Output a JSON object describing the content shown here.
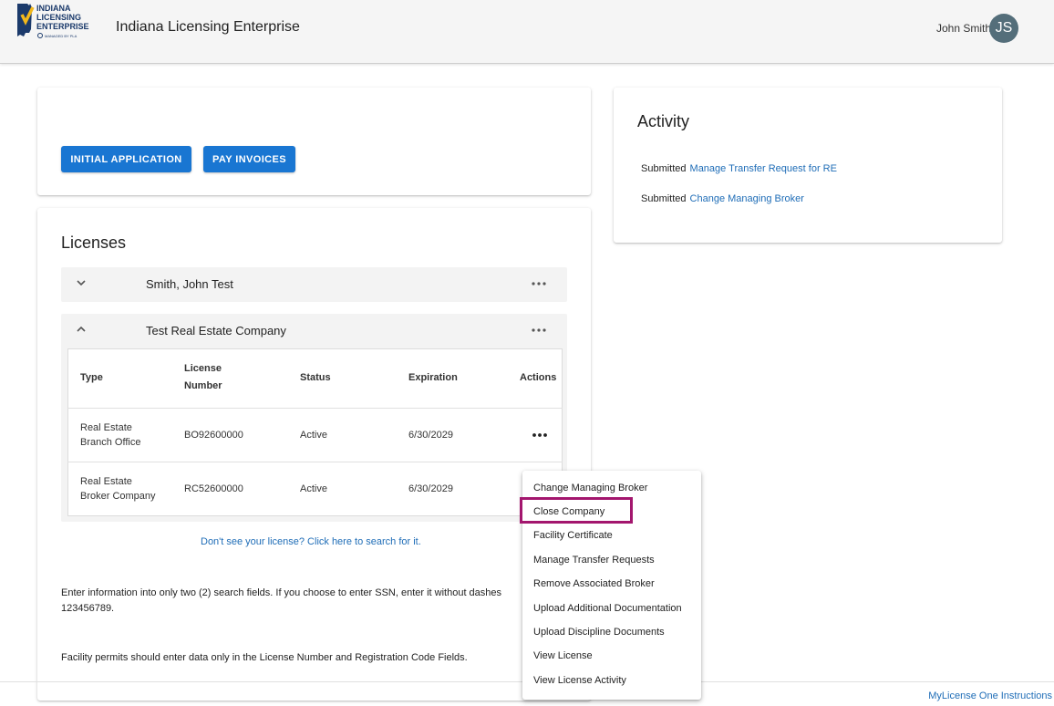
{
  "header": {
    "logo_lines": [
      "INDIANA",
      "LICENSING",
      "ENTERPRISE",
      "MANAGED BY PLA"
    ],
    "title": "Indiana Licensing Enterprise",
    "user_name": "John Smith",
    "avatar_initials": "JS"
  },
  "actions": {
    "initial_application": "INITIAL APPLICATION",
    "pay_invoices": "PAY INVOICES"
  },
  "activity": {
    "title": "Activity",
    "items": [
      {
        "status": "Submitted",
        "link": "Manage Transfer Request for RE"
      },
      {
        "status": "Submitted",
        "link": "Change Managing Broker"
      }
    ]
  },
  "licenses": {
    "title": "Licenses",
    "groups": [
      {
        "name": "Smith, John Test",
        "expanded": false
      },
      {
        "name": "Test Real Estate Company",
        "expanded": true
      }
    ],
    "table": {
      "headers": {
        "type": "Type",
        "license_number_1": "License",
        "license_number_2": "Number",
        "status": "Status",
        "expiration": "Expiration",
        "actions": "Actions"
      },
      "rows": [
        {
          "type_1": "Real Estate",
          "type_2": "Branch Office",
          "number": "BO92600000",
          "status": "Active",
          "expiration": "6/30/2029"
        },
        {
          "type_1": "Real Estate",
          "type_2": "Broker Company",
          "number": "RC52600000",
          "status": "Active",
          "expiration": "6/30/2029"
        }
      ]
    },
    "search_link": "Don't see your license? Click here to search for it.",
    "note1_line1": "Enter information into only two (2) search fields. If you choose to enter SSN, enter it without dashes",
    "note1_line2": "123456789.",
    "note2": "Facility permits should enter data only in the License Number and Registration Code Fields."
  },
  "context_menu": {
    "items": [
      "Change Managing Broker",
      "Close Company",
      "Facility Certificate",
      "Manage Transfer Requests",
      "Remove Associated Broker",
      "Upload Additional Documentation",
      "Upload Discipline Documents",
      "View License",
      "View License Activity"
    ],
    "highlight_color": "#a3166e"
  },
  "footer": {
    "link": "MyLicense One Instructions"
  },
  "colors": {
    "primary": "#1976d2",
    "link": "#1f6db7",
    "avatar": "#546e7a"
  }
}
